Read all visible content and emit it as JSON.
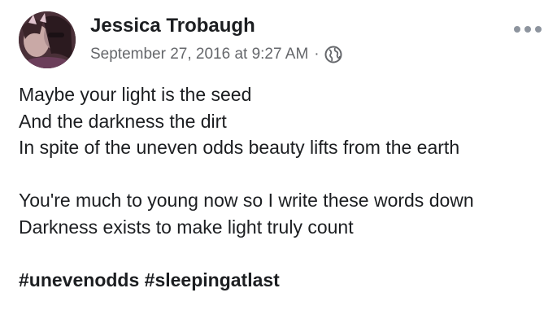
{
  "post": {
    "author": "Jessica Trobaugh",
    "timestamp": "September 27, 2016 at 9:27 AM",
    "separator": "·",
    "privacy_icon": "globe-icon",
    "more_icon": "more-options-icon",
    "avatar_icon": "profile-photo",
    "lines": [
      "Maybe your light is the seed",
      "And the darkness the dirt",
      "In spite of the uneven odds beauty lifts from the earth",
      "You're much to young now so I write these words down",
      "Darkness exists to make light truly count"
    ],
    "hashtags": [
      "#unevenodds",
      "#sleepingatlast"
    ]
  },
  "colors": {
    "text": "#1c1e21",
    "secondary_text": "#65676b",
    "icon_gray": "#8d949e"
  }
}
